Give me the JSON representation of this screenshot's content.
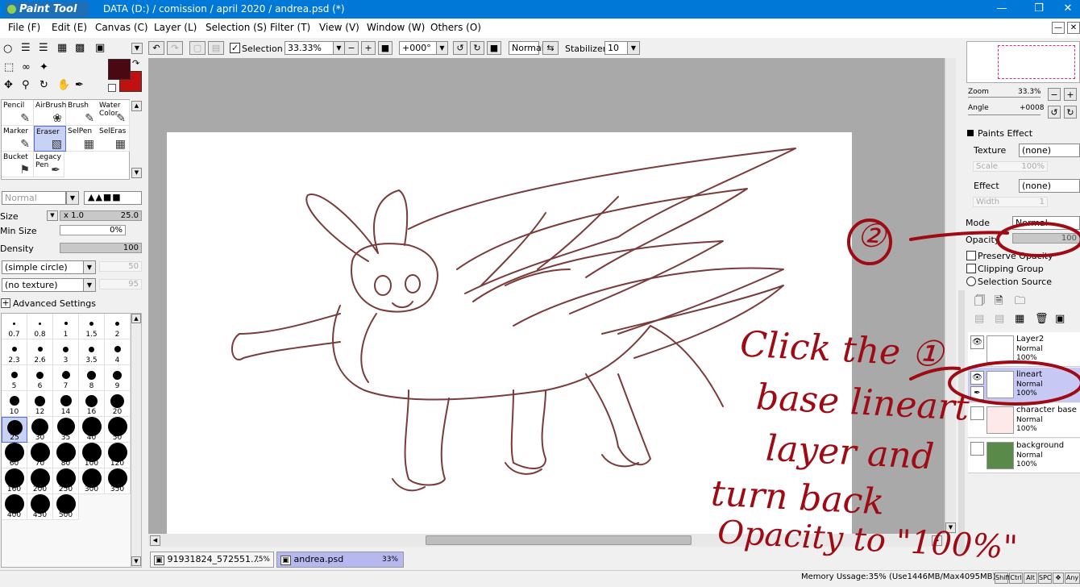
{
  "window": {
    "app_logo": "Paint Tool SAI",
    "title": "DATA (D:) / comission / april 2020 / andrea.psd (*)"
  },
  "menu": [
    {
      "label": "File (F)"
    },
    {
      "label": "Edit (E)"
    },
    {
      "label": "Canvas (C)"
    },
    {
      "label": "Layer (L)"
    },
    {
      "label": "Selection (S)"
    },
    {
      "label": "Filter (T)"
    },
    {
      "label": "View (V)"
    },
    {
      "label": "Window (W)"
    },
    {
      "label": "Others (O)"
    }
  ],
  "toolbar": {
    "selection_label": "Selection",
    "zoom": "33.33%",
    "rotation": "+000°",
    "blend_mode": "Normal",
    "stabilizer_label": "Stabilizer",
    "stabilizer_value": "10"
  },
  "tools": [
    {
      "label": "Pencil"
    },
    {
      "label": "AirBrush"
    },
    {
      "label": "Brush"
    },
    {
      "label": "Water Color"
    },
    {
      "label": "Marker"
    },
    {
      "label": "Eraser"
    },
    {
      "label": "SelPen"
    },
    {
      "label": "SelEras"
    },
    {
      "label": "Bucket"
    },
    {
      "label": "Legacy Pen"
    }
  ],
  "brush_settings": {
    "mode": "Normal",
    "size_label": "Size",
    "size_mult": "x 1.0",
    "size_value": "25.0",
    "min_size_label": "Min Size",
    "min_size_value": "0%",
    "density_label": "Density",
    "density_value": "100",
    "shape": "(simple circle)",
    "shape_value": "50",
    "texture": "(no texture)",
    "texture_value": "95",
    "advanced_label": "Advanced Settings"
  },
  "brush_sizes": [
    "0.7",
    "0.8",
    "1",
    "1.5",
    "2",
    "2.3",
    "2.6",
    "3",
    "3.5",
    "4",
    "5",
    "6",
    "7",
    "8",
    "9",
    "10",
    "12",
    "14",
    "16",
    "20",
    "25",
    "30",
    "35",
    "40",
    "50",
    "60",
    "70",
    "80",
    "100",
    "120",
    "160",
    "200",
    "250",
    "300",
    "350",
    "400",
    "450",
    "500"
  ],
  "navigator": {
    "zoom_label": "Zoom",
    "zoom_value": "33.3%",
    "angle_label": "Angle",
    "angle_value": "+0008"
  },
  "paint_effect": {
    "title": "Paints Effect",
    "texture_label": "Texture",
    "texture_value": "(none)",
    "scale_label": "Scale",
    "scale_value": "100%",
    "effect_label": "Effect",
    "effect_value": "(none)",
    "width_label": "Width",
    "width_value": "1"
  },
  "layer_props": {
    "mode_label": "Mode",
    "mode_value": "Normal",
    "opacity_label": "Opacity",
    "opacity_value": "100",
    "preserve_opacity": "Preserve Opacity",
    "clipping_group": "Clipping Group",
    "selection_source": "Selection Source"
  },
  "layers": [
    {
      "name": "Layer2",
      "mode": "Normal",
      "opacity": "100%"
    },
    {
      "name": "lineart",
      "mode": "Normal",
      "opacity": "100%"
    },
    {
      "name": "character base",
      "mode": "Normal",
      "opacity": "100%"
    },
    {
      "name": "background",
      "mode": "Normal",
      "opacity": "100%"
    }
  ],
  "tabs": [
    {
      "name": "91931824_572551...",
      "zoom": "75%"
    },
    {
      "name": "andrea.psd",
      "zoom": "33%"
    }
  ],
  "status": {
    "memory": "Memory Ussage:35% (Use1446MB/Max4095MB)",
    "keys": [
      "Shift",
      "Ctrl",
      "Alt",
      "SPC",
      "Any"
    ]
  },
  "annotations": {
    "step1_line1": "Click the ①",
    "step1_line2": "base lineart",
    "step1_line3": "layer and",
    "step1_line4": "turn back",
    "step1_line5": "Opacity to \"100%\"",
    "step2": "②"
  },
  "colors": {
    "primary": "#4a0812",
    "secondary": "#c01010",
    "stroke": "#7a3b3b",
    "annotation": "#9e0b14",
    "titlebar": "#0078d7"
  }
}
